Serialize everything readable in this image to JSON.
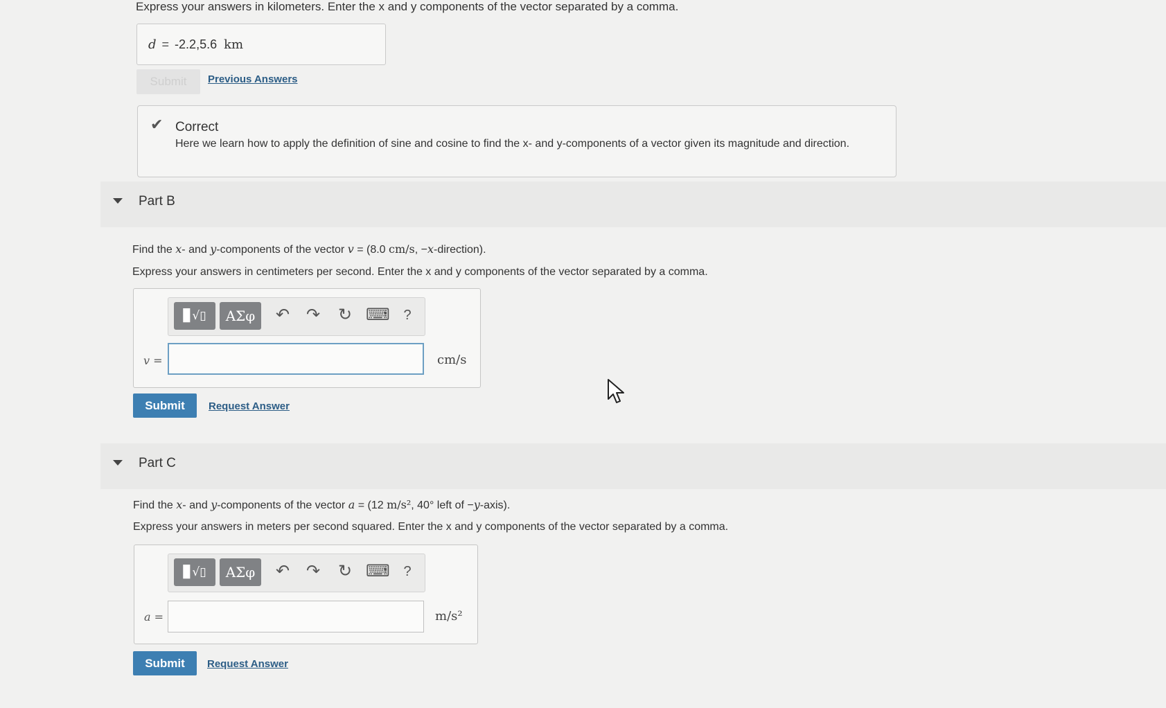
{
  "partA": {
    "instruction_fragment": "Express your answers in kilometers. Enter the x and y components of the vector separated by a comma.",
    "var": "d",
    "eq": "=",
    "answer_value": "-2.2,5.6",
    "unit": "km",
    "submit_label": "Submit",
    "previous_answers_label": "Previous Answers",
    "feedback": {
      "title": "Correct",
      "message": "Here we learn how to apply the definition of sine and cosine to find the x- and y-components of a vector given its magnitude and direction."
    }
  },
  "partB": {
    "label": "Part B",
    "question": {
      "pre": "Find the ",
      "x": "x",
      "mid1": "- and ",
      "y": "y",
      "mid2": "-components of the vector ",
      "var": "v",
      "mid3": " = (8.0 ",
      "unit": "cm/s",
      "mid4": ", −",
      "x2": "x",
      "post": "-direction)."
    },
    "instruction": "Express your answers in centimeters per second. Enter the x and y components of the vector separated by a comma.",
    "toolbar": {
      "templates_label": "▊√▯",
      "greek_label": "ΑΣφ",
      "undo": "↶",
      "redo": "↷",
      "reset": "↻",
      "keyboard": "⌨",
      "help": "?"
    },
    "input_label": "v =",
    "input_value": "",
    "unit": "cm/s",
    "submit_label": "Submit",
    "request_answer_label": "Request Answer"
  },
  "partC": {
    "label": "Part C",
    "question": {
      "pre": "Find the ",
      "x": "x",
      "mid1": "- and ",
      "y": "y",
      "mid2": "-components of the vector ",
      "var": "a",
      "mid3": " = (12 ",
      "unit": "m/s²",
      "mid4": ", 40° left of −",
      "y2": "y",
      "post": "-axis)."
    },
    "instruction": "Express your answers in meters per second squared. Enter the x and y components of the vector separated by a comma.",
    "toolbar": {
      "templates_label": "▊√▯",
      "greek_label": "ΑΣφ",
      "undo": "↶",
      "redo": "↷",
      "reset": "↻",
      "keyboard": "⌨",
      "help": "?"
    },
    "input_label": "a =",
    "input_value": "",
    "unit": "m/s²",
    "submit_label": "Submit",
    "request_answer_label": "Request Answer"
  },
  "colors": {
    "accent": "#3d7fb2",
    "link": "#2c5d86",
    "toolbar_button": "#808285"
  }
}
